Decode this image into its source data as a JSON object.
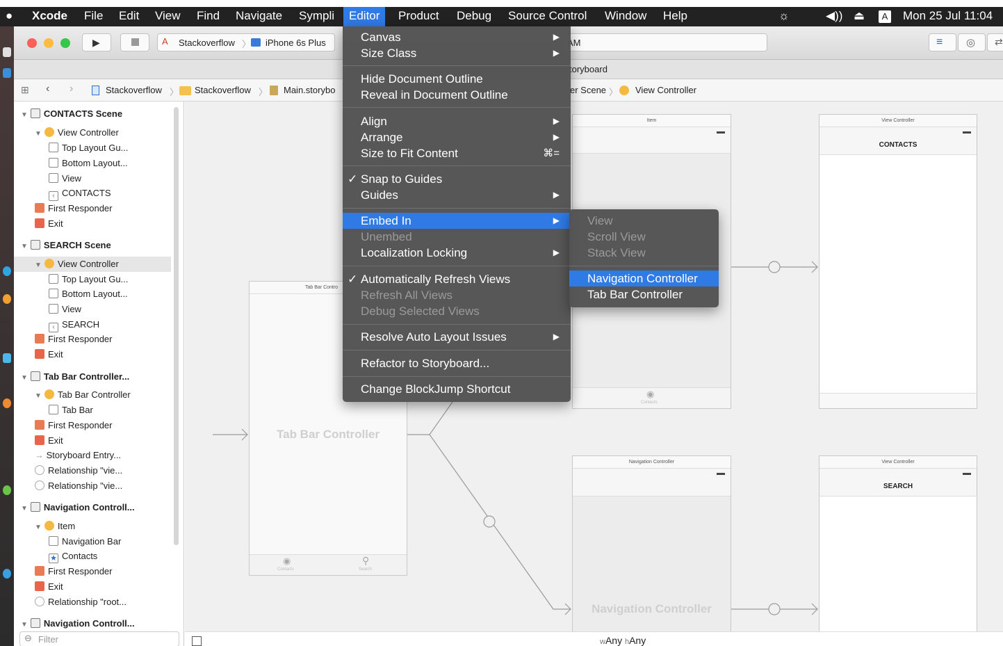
{
  "menubar": {
    "apple": "",
    "items": [
      "Xcode",
      "File",
      "Edit",
      "View",
      "Find",
      "Navigate",
      "Sympli",
      "Editor",
      "Product",
      "Debug",
      "Source Control",
      "Window",
      "Help"
    ],
    "input_badge": "A",
    "clock": "Mon 25 Jul 11:04"
  },
  "toolbar": {
    "scheme": "Stackoverflow",
    "device": "iPhone 6s Plus",
    "status_fragment": "AM"
  },
  "tabbar": {
    "title_fragment": "toryboard"
  },
  "jumpbar": {
    "crumbs": [
      "Stackoverflow",
      "Stackoverflow",
      "Main.storybo"
    ],
    "right_crumbs": [
      "er Scene",
      "View Controller"
    ]
  },
  "outline": {
    "rows": [
      {
        "label": "CONTACTS Scene",
        "type": "scene"
      },
      {
        "label": "View Controller",
        "type": "vc"
      },
      {
        "label": "Top Layout Gu...",
        "type": "guide"
      },
      {
        "label": "Bottom Layout...",
        "type": "guide"
      },
      {
        "label": "View",
        "type": "guide"
      },
      {
        "label": "CONTACTS",
        "type": "nav"
      },
      {
        "label": "First Responder",
        "type": "resp"
      },
      {
        "label": "Exit",
        "type": "exit"
      },
      {
        "label": "SEARCH Scene",
        "type": "scene"
      },
      {
        "label": "View Controller",
        "type": "vc"
      },
      {
        "label": "Top Layout Gu...",
        "type": "guide"
      },
      {
        "label": "Bottom Layout...",
        "type": "guide"
      },
      {
        "label": "View",
        "type": "guide"
      },
      {
        "label": "SEARCH",
        "type": "nav"
      },
      {
        "label": "First Responder",
        "type": "resp"
      },
      {
        "label": "Exit",
        "type": "exit"
      },
      {
        "label": "Tab Bar Controller...",
        "type": "scene"
      },
      {
        "label": "Tab Bar Controller",
        "type": "vc"
      },
      {
        "label": "Tab Bar",
        "type": "guide"
      },
      {
        "label": "First Responder",
        "type": "resp"
      },
      {
        "label": "Exit",
        "type": "exit"
      },
      {
        "label": "Storyboard Entry...",
        "type": "entry"
      },
      {
        "label": "Relationship \"vie...",
        "type": "rel"
      },
      {
        "label": "Relationship \"vie...",
        "type": "rel"
      },
      {
        "label": "Navigation Controll...",
        "type": "scene"
      },
      {
        "label": "Item",
        "type": "vc"
      },
      {
        "label": "Navigation Bar",
        "type": "guide"
      },
      {
        "label": "Contacts",
        "type": "star"
      },
      {
        "label": "First Responder",
        "type": "resp"
      },
      {
        "label": "Exit",
        "type": "exit"
      },
      {
        "label": "Relationship \"root...",
        "type": "rel"
      },
      {
        "label": "Navigation Controll...",
        "type": "scene"
      }
    ],
    "filter_placeholder": "Filter"
  },
  "canvas": {
    "tabbar_controller": {
      "title": "Tab Bar Contro",
      "ghost": "Tab Bar Controller",
      "tab1": "Contacts",
      "tab2": "Search"
    },
    "item_scene": {
      "title": "Item",
      "tab": "Contacts"
    },
    "contacts_vc": {
      "title": "View Controller",
      "nav_title": "CONTACTS"
    },
    "nav_controller": {
      "title": "Navigation Controller",
      "ghost": "Navigation Controller"
    },
    "search_vc": {
      "title": "View Controller",
      "nav_title": "SEARCH"
    },
    "size_class_w": "Any",
    "size_class_h": "Any",
    "size_class_w_prefix": "w",
    "size_class_h_prefix": "h"
  },
  "editor_menu": {
    "canvas": "Canvas",
    "size_class": "Size Class",
    "hide_outline": "Hide Document Outline",
    "reveal_outline": "Reveal in Document Outline",
    "align": "Align",
    "arrange": "Arrange",
    "size_to_fit": "Size to Fit Content",
    "size_to_fit_shortcut": "⌘=",
    "snap": "Snap to Guides",
    "guides": "Guides",
    "embed_in": "Embed In",
    "unembed": "Unembed",
    "localization": "Localization Locking",
    "auto_refresh": "Automatically Refresh Views",
    "refresh_all": "Refresh All Views",
    "debug_selected": "Debug Selected Views",
    "resolve": "Resolve Auto Layout Issues",
    "refactor": "Refactor to Storyboard...",
    "change_shortcut": "Change BlockJump Shortcut"
  },
  "embed_submenu": {
    "view": "View",
    "scroll_view": "Scroll View",
    "stack_view": "Stack View",
    "navigation_controller": "Navigation Controller",
    "tab_bar_controller": "Tab Bar Controller"
  }
}
